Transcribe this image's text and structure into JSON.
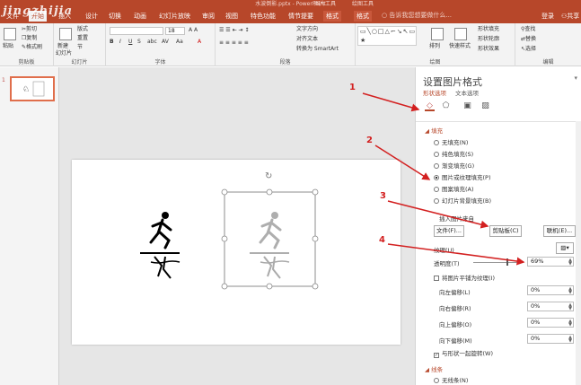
{
  "window": {
    "title": "水波倒影.pptx - PowerPoint",
    "context_tool": "图片工具",
    "context_group": "绘图工具"
  },
  "tabs": {
    "file": "文件",
    "home": "开始",
    "insert": "插入",
    "design": "设计",
    "transitions": "切换",
    "animations": "动画",
    "slideshow": "幻灯片放映",
    "review": "审阅",
    "view": "视图",
    "special": "特色功能",
    "storyboard": "情节提要",
    "format1": "格式",
    "format2": "格式",
    "tellme": "告诉我您想要做什么...",
    "signin": "登录",
    "share": "共享"
  },
  "watermark": "jingzhijia",
  "ribbon": {
    "clipboard": {
      "label": "剪贴板",
      "paste": "粘贴",
      "cut": "剪切",
      "copy": "复制",
      "painter": "格式刷"
    },
    "slides": {
      "label": "幻灯片",
      "new": "新建",
      "new2": "幻灯片",
      "layout": "版式",
      "reset": "重置",
      "section": "节"
    },
    "font": {
      "label": "字体",
      "size": "18"
    },
    "paragraph": {
      "label": "段落",
      "direction": "文字方向",
      "align": "对齐文本",
      "smartart": "转换为 SmartArt"
    },
    "drawing": {
      "label": "绘图",
      "arrange": "排列",
      "quickstyle": "快速样式",
      "fill": "形状填充",
      "outline": "形状轮廓",
      "effect": "形状效果"
    },
    "editing": {
      "label": "编辑",
      "find": "查找",
      "replace": "替换",
      "select": "选择"
    }
  },
  "thumbs": {
    "num": "1"
  },
  "pane": {
    "title": "设置图片格式",
    "tab_shape": "形状选项",
    "tab_text": "文本选项",
    "fill_section": "填充",
    "options": [
      "无填充(N)",
      "纯色填充(S)",
      "渐变填充(G)",
      "图片或纹理填充(P)",
      "图案填充(A)",
      "幻灯片背景填充(B)"
    ],
    "insert_from": "插入图片来自",
    "file_btn": "文件(F)...",
    "clip_btn": "剪贴板(C)",
    "online_btn": "联机(E)...",
    "texture": "纹理(U)",
    "transparency": "透明度(T)",
    "transparency_value": "69%",
    "tile": "将图片平铺为纹理(I)",
    "offsets": [
      {
        "label": "向左偏移(L)",
        "value": "0%"
      },
      {
        "label": "向右偏移(R)",
        "value": "0%"
      },
      {
        "label": "向上偏移(O)",
        "value": "0%"
      },
      {
        "label": "向下偏移(M)",
        "value": "0%"
      }
    ],
    "rotate": "与形状一起旋转(W)",
    "line_section": "线条",
    "no_line": "无线条(N)"
  },
  "annotations": {
    "a1": "1",
    "a2": "2",
    "a3": "3",
    "a4": "4"
  },
  "colors": {
    "accent": "#b7472a",
    "arrow": "#d32020"
  }
}
